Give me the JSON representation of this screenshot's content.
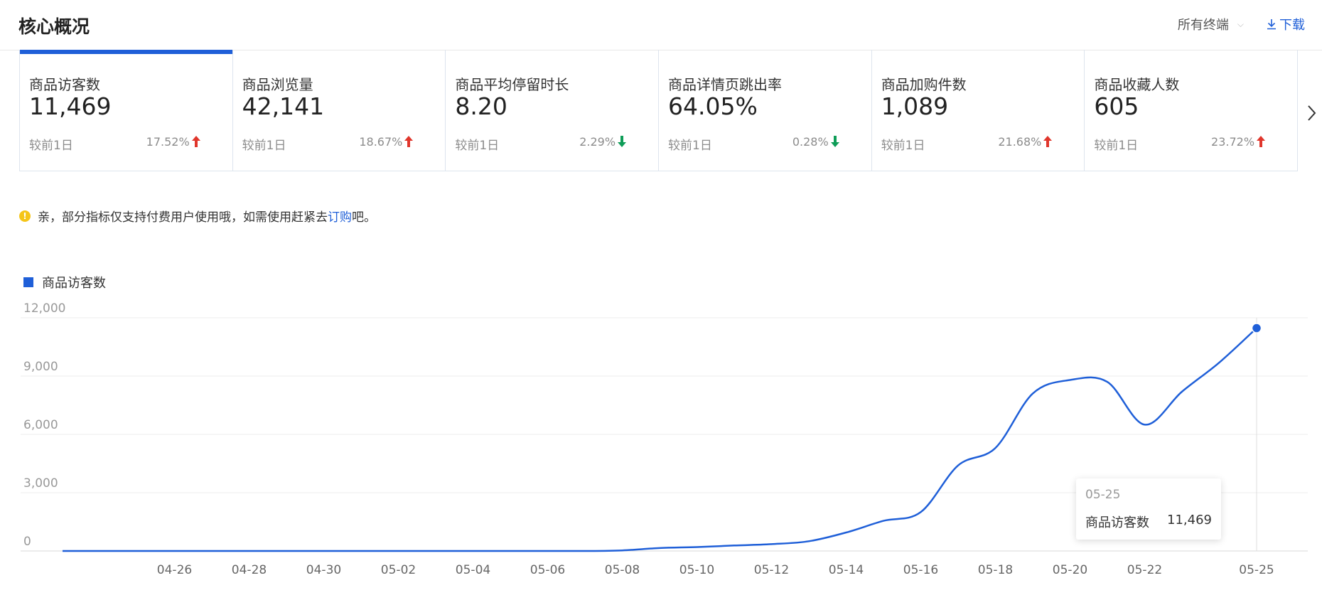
{
  "header": {
    "title": "核心概况",
    "terminal": "所有终端",
    "download": "下载"
  },
  "metrics": [
    {
      "label": "商品访客数",
      "value": "11,469",
      "compare": "较前1日",
      "change": "17.52%",
      "direction": "up"
    },
    {
      "label": "商品浏览量",
      "value": "42,141",
      "compare": "较前1日",
      "change": "18.67%",
      "direction": "up"
    },
    {
      "label": "商品平均停留时长",
      "value": "8.20",
      "compare": "较前1日",
      "change": "2.29%",
      "direction": "down"
    },
    {
      "label": "商品详情页跳出率",
      "value": "64.05%",
      "compare": "较前1日",
      "change": "0.28%",
      "direction": "down"
    },
    {
      "label": "商品加购件数",
      "value": "1,089",
      "compare": "较前1日",
      "change": "21.68%",
      "direction": "up"
    },
    {
      "label": "商品收藏人数",
      "value": "605",
      "compare": "较前1日",
      "change": "23.72%",
      "direction": "up"
    }
  ],
  "notice": {
    "text": "亲，部分指标仅支持付费用户使用哦，如需使用赶紧去 ",
    "link": "订购",
    "suffix": "吧。"
  },
  "colors": {
    "accent": "#1f5fd8",
    "up": "#e0362c",
    "down": "#0f9d58"
  },
  "chart_data": {
    "type": "line",
    "series": [
      {
        "name": "商品访客数",
        "values": [
          0,
          0,
          0,
          0,
          0,
          0,
          0,
          0,
          0,
          0,
          0,
          0,
          0,
          0,
          0,
          30,
          150,
          200,
          280,
          350,
          500,
          950,
          1550,
          2000,
          4400,
          5300,
          8100,
          8800,
          8700,
          6500,
          8200,
          9700,
          11469
        ]
      }
    ],
    "x_dates": [
      "04-23",
      "04-24",
      "04-25",
      "04-26",
      "04-27",
      "04-28",
      "04-29",
      "04-30",
      "05-01",
      "05-02",
      "05-03",
      "05-04",
      "05-05",
      "05-06",
      "05-07",
      "05-08",
      "05-09",
      "05-10",
      "05-11",
      "05-12",
      "05-13",
      "05-14",
      "05-15",
      "05-16",
      "05-17",
      "05-18",
      "05-19",
      "05-20",
      "05-21",
      "05-22",
      "05-23",
      "05-24",
      "05-25"
    ],
    "x_tick_labels": [
      "04-26",
      "04-28",
      "04-30",
      "05-02",
      "05-04",
      "05-06",
      "05-08",
      "05-10",
      "05-12",
      "05-14",
      "05-16",
      "05-18",
      "05-20",
      "05-22",
      "05-25"
    ],
    "y_ticks": [
      0,
      3000,
      6000,
      9000,
      12000
    ],
    "y_tick_labels": [
      "0",
      "3,000",
      "6,000",
      "9,000",
      "12,000"
    ],
    "ylim": [
      0,
      12000
    ],
    "grid": true,
    "legend": "top-left",
    "tooltip": {
      "date": "05-25",
      "series": "商品访客数",
      "value": "11,469"
    }
  }
}
